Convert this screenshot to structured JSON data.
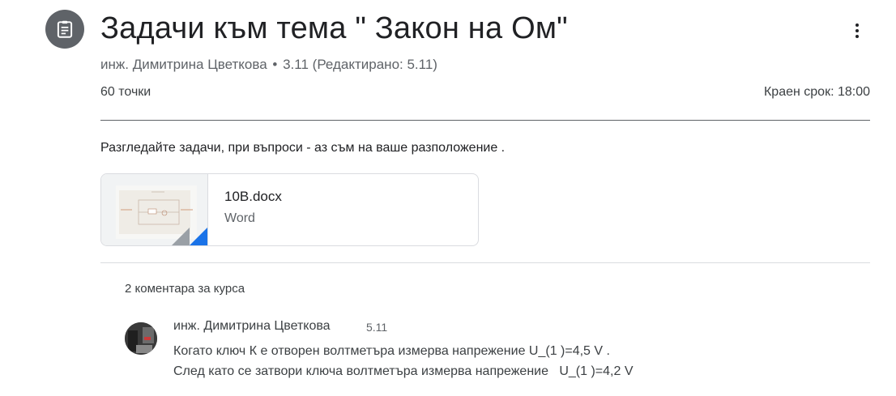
{
  "assignment": {
    "icon": "assignment-icon",
    "title": "Задачи към тема \" Закон на Ом\"",
    "author": "инж. Димитрина Цветкова",
    "separator": "•",
    "posted": "3.11",
    "edited": "(Редактирано: 5.11)",
    "points": "60 точки",
    "due": "Краен срок: 18:00",
    "instructions": "Разгледайте задачи, при въпроси - аз съм на ваше разположение ."
  },
  "attachment": {
    "name": "10B.docx",
    "type": "Word",
    "accent_color": "#1a73e8"
  },
  "comments": {
    "count_label": "2 коментара за курса",
    "items": [
      {
        "author": "инж. Димитрина Цветкова",
        "date": "5.11",
        "line1": "Когато ключ К е отворен волтметъра измерва напрежение U_(1 )=4,5 V .",
        "line2": "След като се затвори ключа волтметъра измерва напрежение   U_(1 )=4,2 V"
      }
    ]
  },
  "colors": {
    "icon_bg": "#5f6368",
    "text_primary": "#202124",
    "text_secondary": "#5f6368"
  }
}
